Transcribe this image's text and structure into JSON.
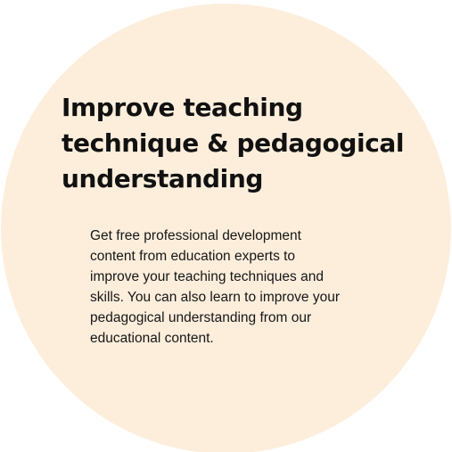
{
  "card": {
    "title_lines": [
      "Improve teaching",
      "technique & pedagogical",
      "understanding"
    ],
    "description_lines": [
      "Get free professional development",
      "content from education experts to",
      "improve your teaching techniques and",
      "skills. You can also learn to improve your",
      "pedagogical understanding from our",
      "educational content."
    ]
  },
  "colors": {
    "background": "#ffffff",
    "circle": "#fdeedc",
    "text": "#111111"
  }
}
